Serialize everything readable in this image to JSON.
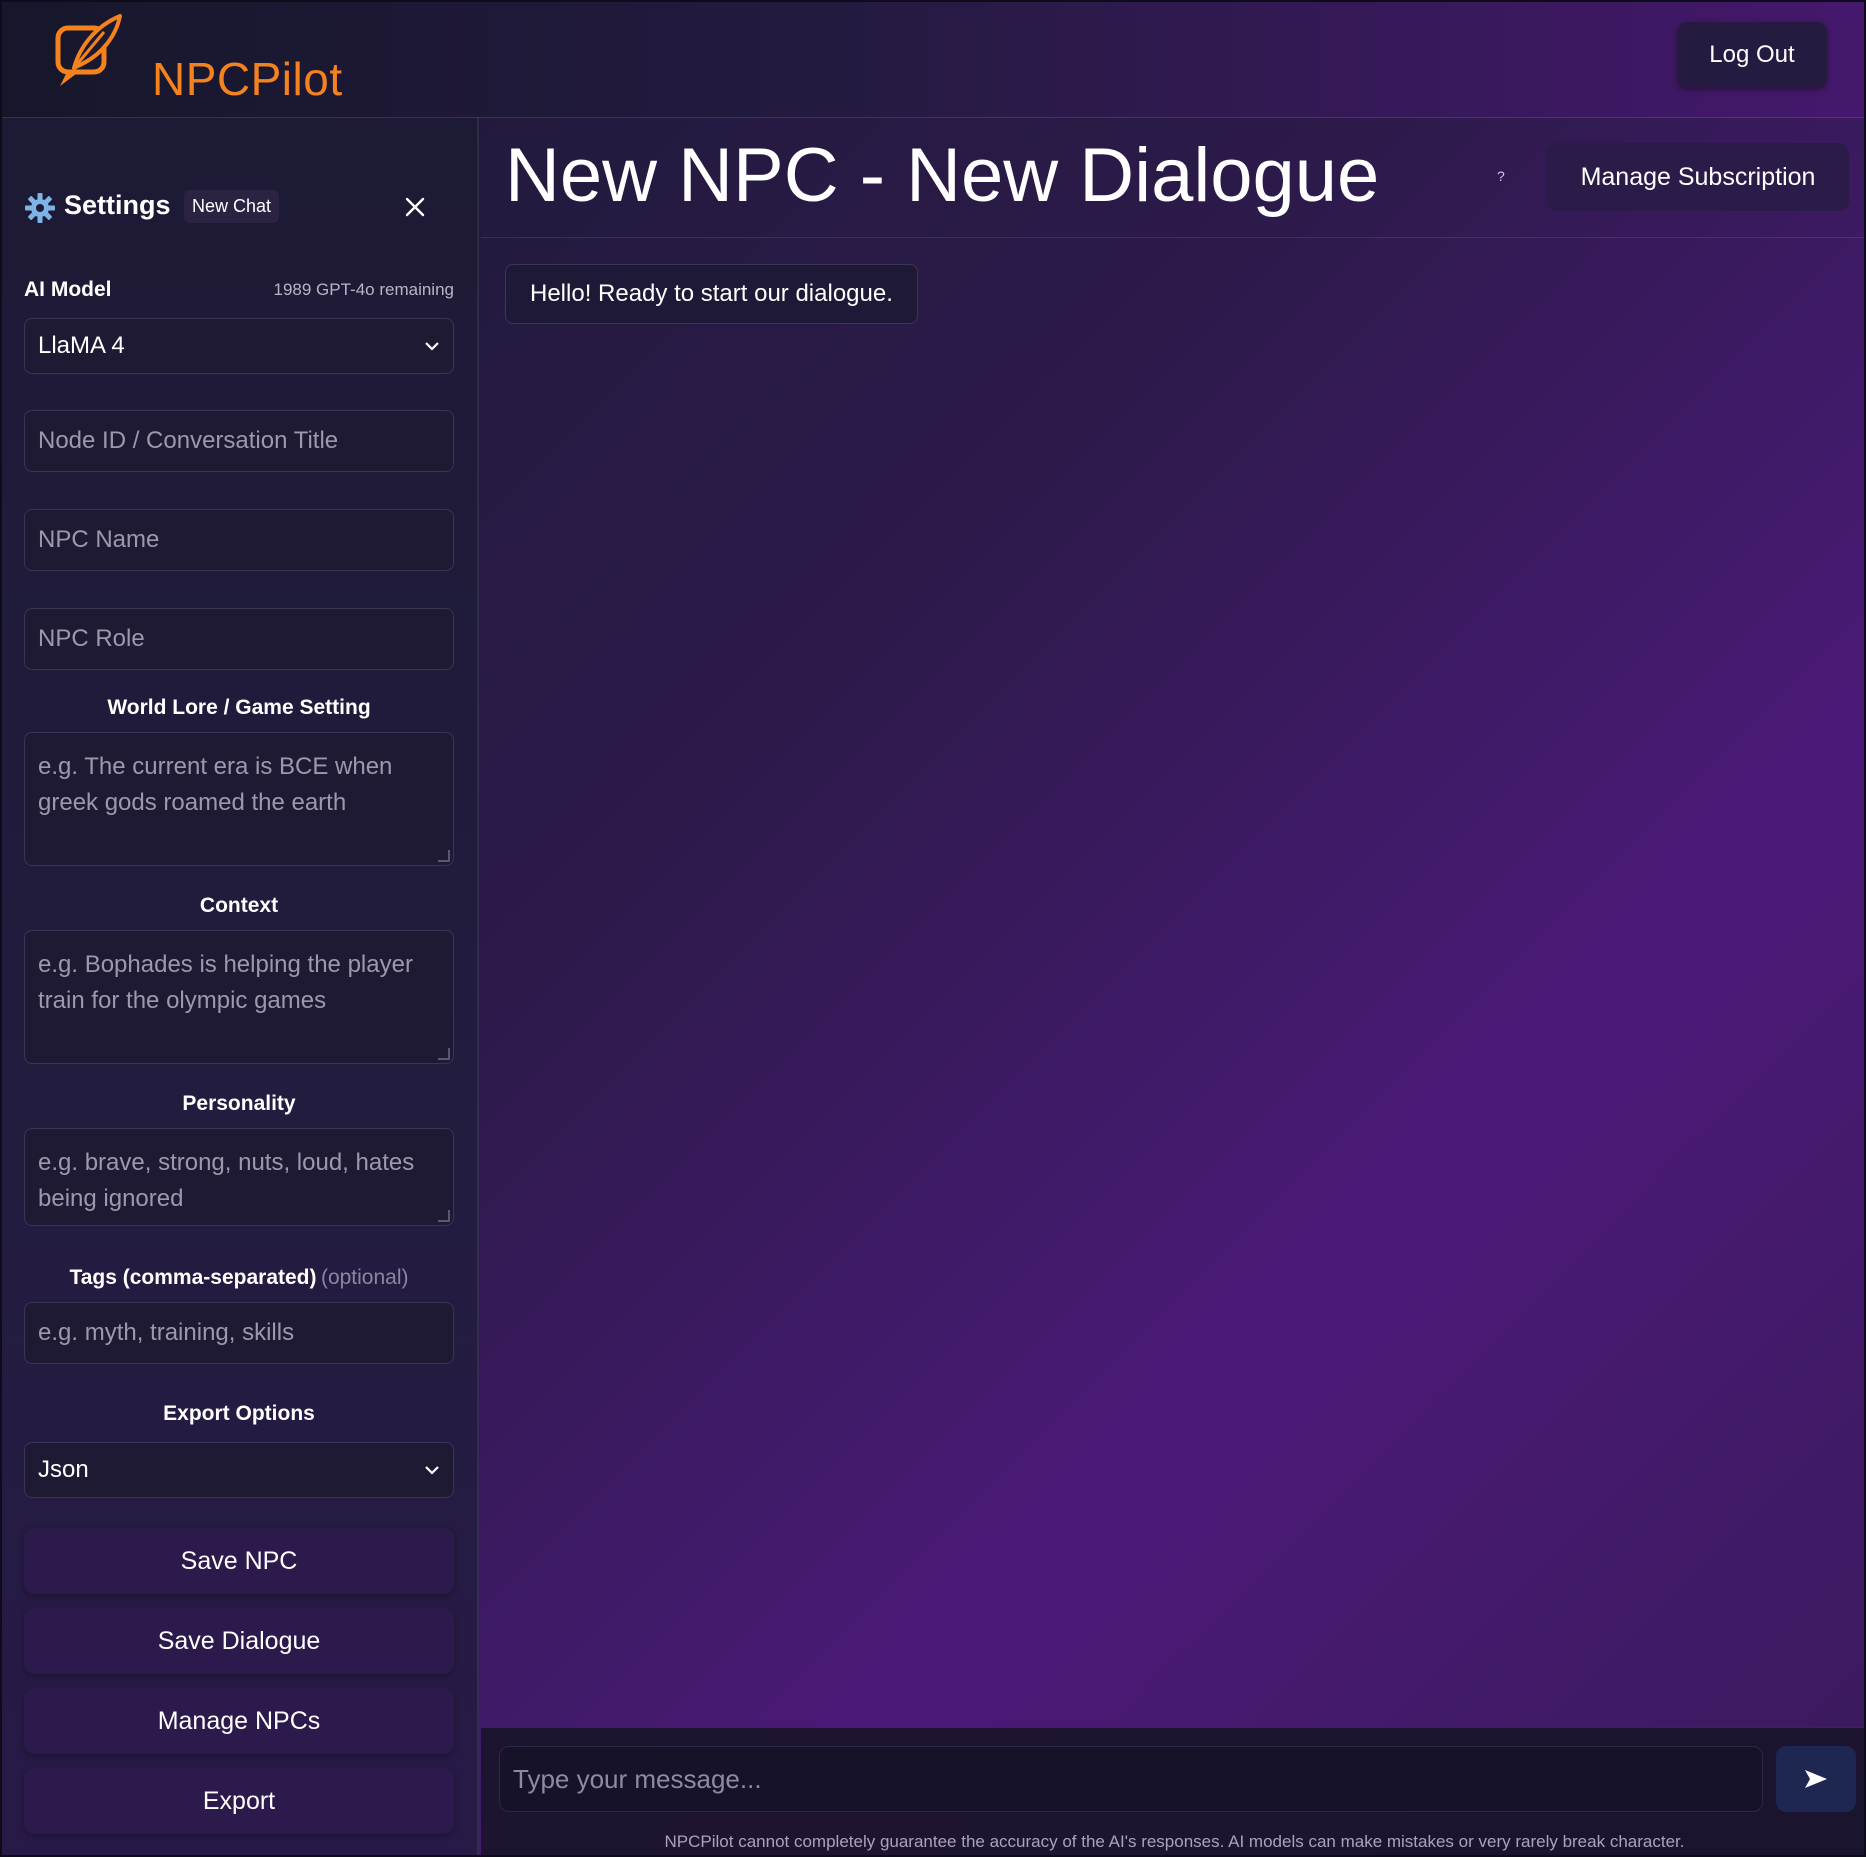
{
  "app": {
    "name": "NPCPilot",
    "logout_label": "Log Out",
    "brand_color": "#f4821f"
  },
  "sidebar": {
    "title": "Settings",
    "new_chat_label": "New Chat",
    "ai_model": {
      "label": "AI Model",
      "remaining": "1989 GPT-4o remaining",
      "selected": "LlaMA 4"
    },
    "fields": {
      "node_id_placeholder": "Node ID / Conversation Title",
      "npc_name_placeholder": "NPC Name",
      "npc_role_placeholder": "NPC Role"
    },
    "world_lore": {
      "label": "World Lore / Game Setting",
      "placeholder": "e.g. The current era is BCE when greek gods roamed the earth"
    },
    "context": {
      "label": "Context",
      "placeholder": "e.g. Bophades is helping the player train for the olympic games"
    },
    "personality": {
      "label": "Personality",
      "placeholder": "e.g. brave, strong, nuts, loud, hates being ignored"
    },
    "tags": {
      "label": "Tags (comma-separated)",
      "optional": "(optional)",
      "placeholder": "e.g. myth, training, skills"
    },
    "export_options": {
      "label": "Export Options",
      "selected": "Json"
    },
    "buttons": {
      "save_npc": "Save NPC",
      "save_dialogue": "Save Dialogue",
      "manage_npcs": "Manage NPCs",
      "export": "Export"
    }
  },
  "main": {
    "title": "New NPC - New Dialogue",
    "help": "?",
    "manage_subscription": "Manage Subscription",
    "messages": [
      {
        "text": "Hello! Ready to start our dialogue."
      }
    ],
    "composer": {
      "placeholder": "Type your message...",
      "disclaimer": "NPCPilot cannot completely guarantee the accuracy of the AI's responses. AI models can make mistakes or very rarely break character."
    }
  },
  "icons": {
    "logo": "quill-speech-bubble-icon",
    "settings": "gear-icon",
    "close": "close-icon",
    "dropdown": "chevron-down-icon",
    "send": "send-icon"
  }
}
